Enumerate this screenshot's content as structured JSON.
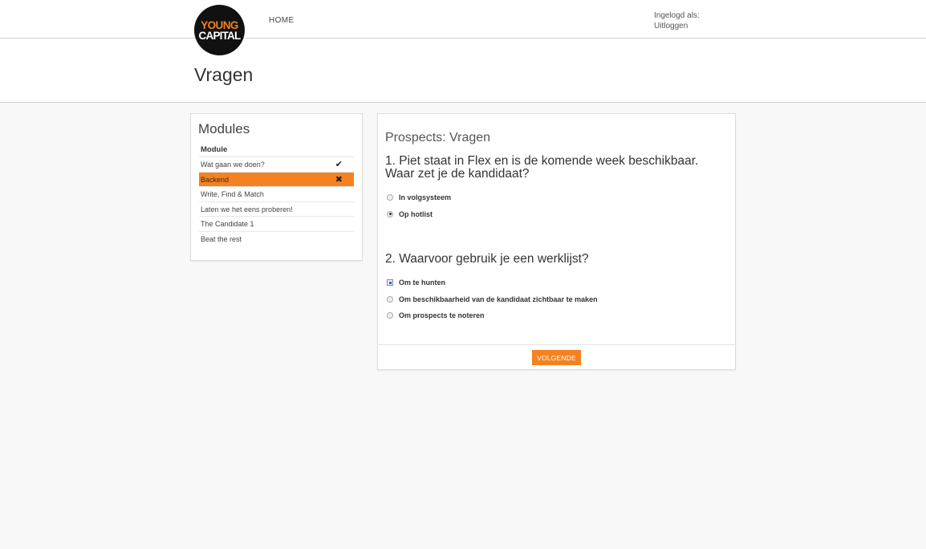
{
  "header": {
    "logo_line1": "YOUNG",
    "logo_line2": "CAPITAL",
    "nav_home": "HOME",
    "logged_in_label": "Ingelogd als:",
    "logout_label": "Uitloggen"
  },
  "page": {
    "title": "Vragen"
  },
  "modules": {
    "title": "Modules",
    "column_header": "Module",
    "items": [
      {
        "label": "Wat gaan we doen?",
        "status": "✔",
        "status_icon": "check-icon"
      },
      {
        "label": "Backend",
        "status": "✖",
        "status_icon": "cross-icon",
        "active": true
      },
      {
        "label": "Write, Find & Match",
        "status": ""
      },
      {
        "label": "Laten we het eens proberen!",
        "status": ""
      },
      {
        "label": "The Candidate 1",
        "status": ""
      },
      {
        "label": "Beat the rest",
        "status": ""
      }
    ]
  },
  "quiz": {
    "title": "Prospects: Vragen",
    "questions": [
      {
        "text": "1. Piet staat in Flex en is de komende week beschikbaar. Waar zet je de kandidaat?",
        "type": "radio",
        "options": [
          {
            "label": "In volgsysteem",
            "selected": false
          },
          {
            "label": "Op hotlist",
            "selected": true
          }
        ]
      },
      {
        "text": "2. Waarvoor gebruik je een werklijst?",
        "type": "mixed",
        "options": [
          {
            "label": "Om te hunten",
            "selected": true
          },
          {
            "label": "Om beschikbaarheid van de kandidaat zichtbaar te maken",
            "selected": false
          },
          {
            "label": "Om prospects te noteren",
            "selected": false
          }
        ]
      }
    ],
    "next_button": "VOLGENDE"
  },
  "colors": {
    "accent": "#f58220",
    "background": "#f8f8f8",
    "panel": "#ffffff"
  }
}
